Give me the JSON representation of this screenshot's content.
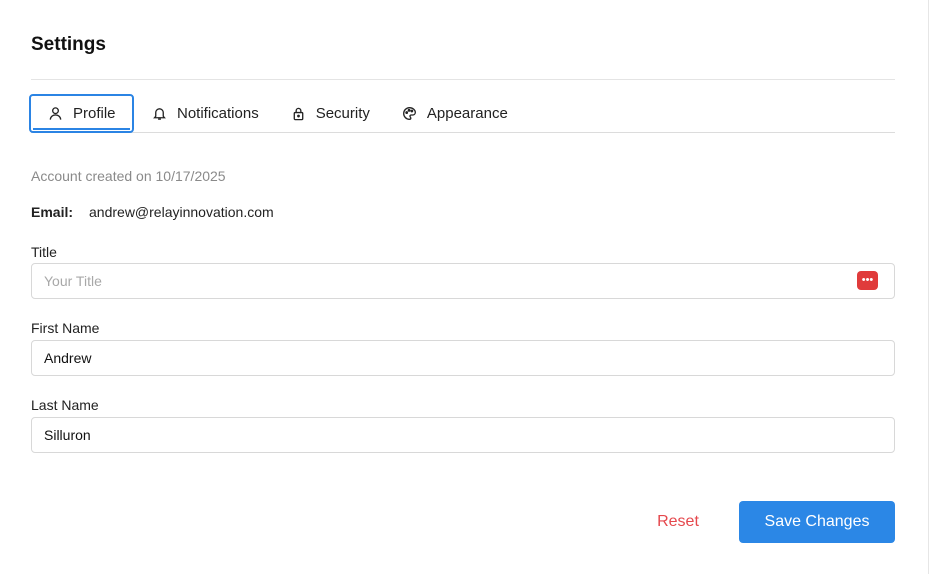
{
  "header": {
    "title": "Settings"
  },
  "tabs": [
    {
      "label": "Profile",
      "icon": "user-icon",
      "active": true
    },
    {
      "label": "Notifications",
      "icon": "bell-icon",
      "active": false
    },
    {
      "label": "Security",
      "icon": "lock-icon",
      "active": false
    },
    {
      "label": "Appearance",
      "icon": "palette-icon",
      "active": false
    }
  ],
  "profile": {
    "created_text": "Account created on 10/17/2025",
    "email_label": "Email:",
    "email_value": "andrew@relayinnovation.com",
    "title_label": "Title",
    "title_value": "",
    "title_placeholder": "Your Title",
    "first_name_label": "First Name",
    "first_name_value": "Andrew",
    "last_name_label": "Last Name",
    "last_name_value": "Silluron"
  },
  "password_manager_badge": {
    "icon": "password-manager-icon",
    "glyph": "•••",
    "color": "#e03b3b"
  },
  "actions": {
    "reset_label": "Reset",
    "save_label": "Save Changes"
  },
  "colors": {
    "accent": "#2b87e6",
    "danger": "#e5484d"
  }
}
